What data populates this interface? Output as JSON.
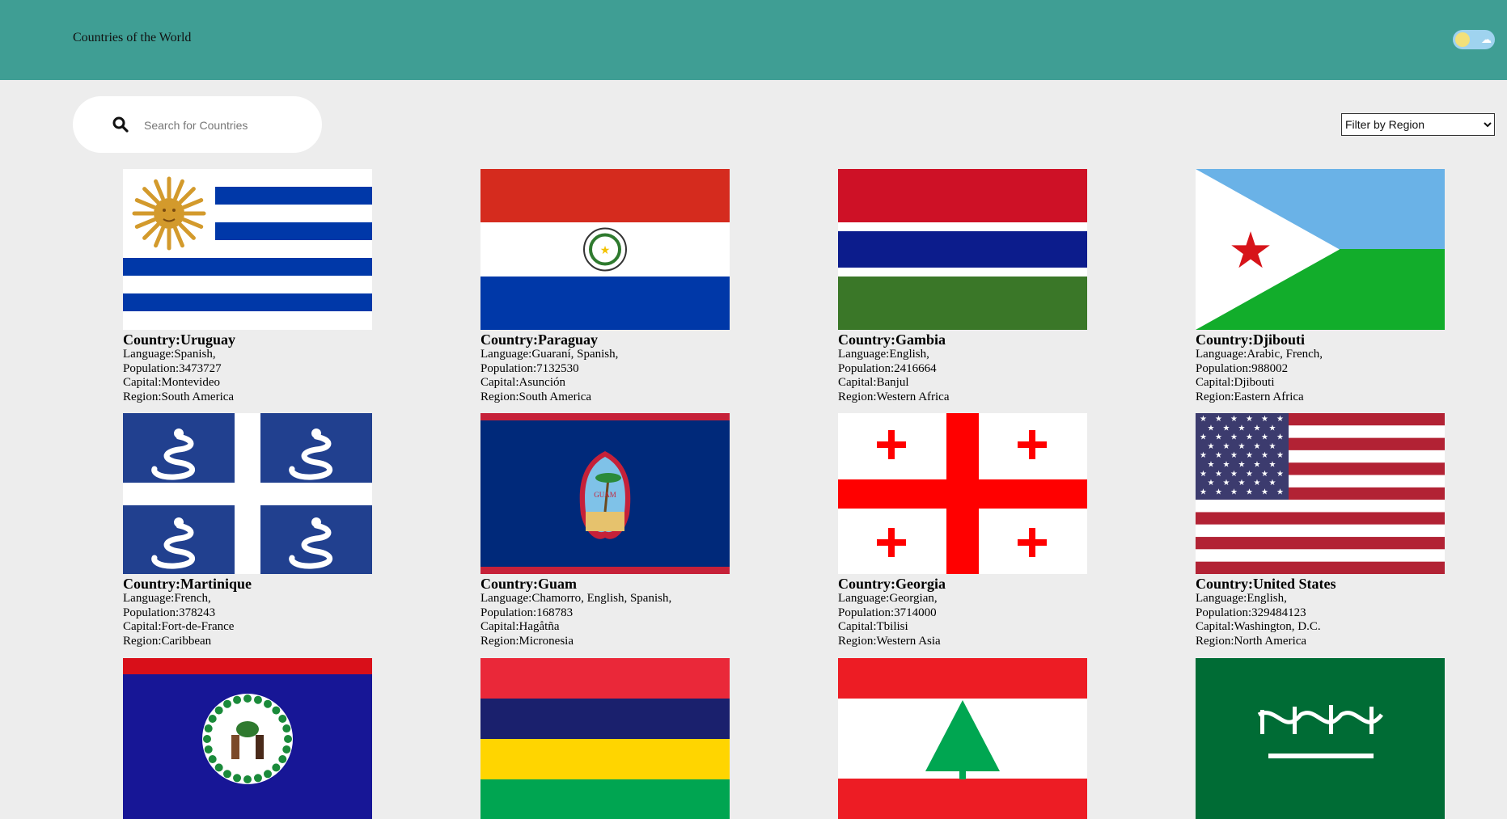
{
  "header": {
    "title": "Countries of the World"
  },
  "toolbar": {
    "search_placeholder": "Search for Countries",
    "filter_selected": "Filter by Region"
  },
  "labels": {
    "country": "Country:",
    "language": "Language:",
    "population": "Population:",
    "capital": "Capital:",
    "region": "Region:"
  },
  "cards": [
    {
      "name": "Uruguay",
      "languages": "Spanish,",
      "population": "3473727",
      "capital": "Montevideo",
      "region": "South America"
    },
    {
      "name": "Paraguay",
      "languages": "Guaraní, Spanish,",
      "population": "7132530",
      "capital": "Asunción",
      "region": "South America"
    },
    {
      "name": "Gambia",
      "languages": "English,",
      "population": "2416664",
      "capital": "Banjul",
      "region": "Western Africa"
    },
    {
      "name": "Djibouti",
      "languages": "Arabic, French,",
      "population": "988002",
      "capital": "Djibouti",
      "region": "Eastern Africa"
    },
    {
      "name": "Martinique",
      "languages": "French,",
      "population": "378243",
      "capital": "Fort-de-France",
      "region": "Caribbean"
    },
    {
      "name": "Guam",
      "languages": "Chamorro, English, Spanish,",
      "population": "168783",
      "capital": "Hagåtña",
      "region": "Micronesia"
    },
    {
      "name": "Georgia",
      "languages": "Georgian,",
      "population": "3714000",
      "capital": "Tbilisi",
      "region": "Western Asia"
    },
    {
      "name": "United States",
      "languages": "English,",
      "population": "329484123",
      "capital": "Washington, D.C.",
      "region": "North America"
    },
    {
      "flag": "belize"
    },
    {
      "flag": "mauritius"
    },
    {
      "flag": "lebanon"
    },
    {
      "flag": "saudi-arabia"
    }
  ],
  "flags": [
    "uruguay",
    "paraguay",
    "gambia",
    "djibouti",
    "martinique",
    "guam",
    "georgia",
    "united-states",
    "belize",
    "mauritius",
    "lebanon",
    "saudi-arabia"
  ],
  "flag_seal_text": {
    "guam": "GUAM"
  }
}
